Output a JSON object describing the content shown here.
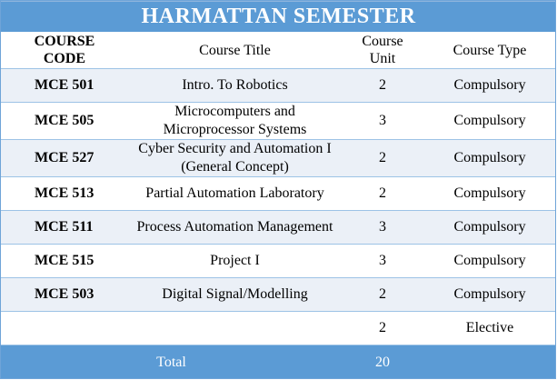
{
  "title": "HARMATTAN SEMESTER",
  "headers": {
    "code_line1": "COURSE",
    "code_line2": "CODE",
    "title": "Course Title",
    "unit_line1": "Course",
    "unit_line2": "Unit",
    "type": "Course Type"
  },
  "rows": [
    {
      "code": "MCE 501",
      "title_line1": "Intro. To Robotics",
      "title_line2": "",
      "unit": "2",
      "type": "Compulsory"
    },
    {
      "code": "MCE 505",
      "title_line1": "Microcomputers and",
      "title_line2": "Microprocessor Systems",
      "unit": "3",
      "type": "Compulsory"
    },
    {
      "code": "MCE 527",
      "title_line1": "Cyber Security and Automation I",
      "title_line2": "(General Concept)",
      "unit": "2",
      "type": "Compulsory"
    },
    {
      "code": "MCE 513",
      "title_line1": "Partial Automation Laboratory",
      "title_line2": "",
      "unit": "2",
      "type": "Compulsory"
    },
    {
      "code": "MCE 511",
      "title_line1": "Process Automation Management",
      "title_line2": "",
      "unit": "3",
      "type": "Compulsory"
    },
    {
      "code": "MCE 515",
      "title_line1": "Project I",
      "title_line2": "",
      "unit": "3",
      "type": "Compulsory"
    },
    {
      "code": "MCE 503",
      "title_line1": "Digital Signal/Modelling",
      "title_line2": "",
      "unit": "2",
      "type": "Compulsory"
    },
    {
      "code": "",
      "title_line1": "",
      "title_line2": "",
      "unit": "2",
      "type": "Elective"
    }
  ],
  "total": {
    "label": "Total",
    "value": "20"
  },
  "colors": {
    "header_blue": "#5b9bd5",
    "row_shade": "#ebf0f7",
    "rule": "#9dc3e6"
  }
}
